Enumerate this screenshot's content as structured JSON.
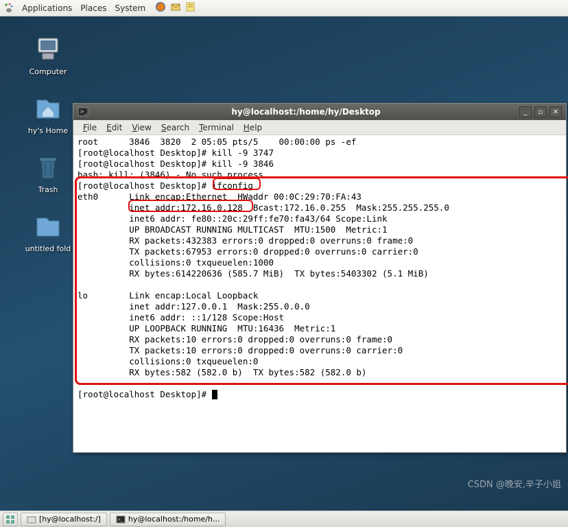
{
  "panel": {
    "menus": [
      "Applications",
      "Places",
      "System"
    ]
  },
  "desktop_icons": {
    "computer": "Computer",
    "home": "hy's Home",
    "trash": "Trash",
    "untitled": "untitled fold"
  },
  "window": {
    "title": "hy@localhost:/home/hy/Desktop",
    "menubar": {
      "file": "File",
      "edit": "Edit",
      "view": "View",
      "search": "Search",
      "terminal": "Terminal",
      "help": "Help"
    }
  },
  "terminal": {
    "lines": [
      "root      3846  3820  2 05:05 pts/5    00:00:00 ps -ef",
      "[root@localhost Desktop]# kill -9 3747",
      "[root@localhost Desktop]# kill -9 3846",
      "bash: kill: (3846) - No such process",
      "[root@localhost Desktop]# ifconfig",
      "eth0      Link encap:Ethernet  HWaddr 00:0C:29:70:FA:43  ",
      "          inet addr:172.16.0.128  Bcast:172.16.0.255  Mask:255.255.255.0",
      "          inet6 addr: fe80::20c:29ff:fe70:fa43/64 Scope:Link",
      "          UP BROADCAST RUNNING MULTICAST  MTU:1500  Metric:1",
      "          RX packets:432383 errors:0 dropped:0 overruns:0 frame:0",
      "          TX packets:67953 errors:0 dropped:0 overruns:0 carrier:0",
      "          collisions:0 txqueuelen:1000 ",
      "          RX bytes:614220636 (585.7 MiB)  TX bytes:5403302 (5.1 MiB)",
      "",
      "lo        Link encap:Local Loopback  ",
      "          inet addr:127.0.0.1  Mask:255.0.0.0",
      "          inet6 addr: ::1/128 Scope:Host",
      "          UP LOOPBACK RUNNING  MTU:16436  Metric:1",
      "          RX packets:10 errors:0 dropped:0 overruns:0 frame:0",
      "          TX packets:10 errors:0 dropped:0 overruns:0 carrier:0",
      "          collisions:0 txqueuelen:0 ",
      "          RX bytes:582 (582.0 b)  TX bytes:582 (582.0 b)",
      "",
      "[root@localhost Desktop]# "
    ]
  },
  "taskbar": {
    "item1": "[hy@localhost:/]",
    "item2": "hy@localhost:/home/h..."
  },
  "watermark": "CSDN @晚安,辛子小姐"
}
